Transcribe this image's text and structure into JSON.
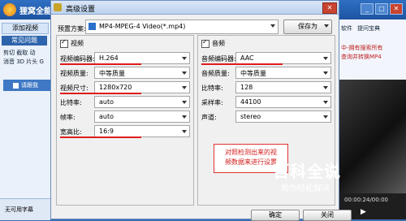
{
  "bg_app": {
    "title": "狸窝全能转",
    "tab_add_video": "添加视频",
    "tab_faq": "常见问题",
    "menu_lines": [
      "剪切 截取 动",
      "消音 3D 片头 G"
    ],
    "row_text": "请跟我",
    "bottom_text": "无可用字幕",
    "right_tabs": [
      "软件",
      "提问宝典"
    ],
    "right_links": [
      "中-拥有搜索所有",
      "查询并转换MP4"
    ],
    "time_text": "00:00:24/00:00",
    "play_icon": "play-icon"
  },
  "dialog": {
    "title": "高级设置",
    "preset_label": "预置方案:",
    "preset_value": "MP4-MPEG-4 Video(*.mp4)",
    "save_as": "保存为",
    "video": {
      "header": "视频",
      "fields": [
        {
          "label": "视频编码器:",
          "value": "H.264"
        },
        {
          "label": "视频质量:",
          "value": "中等质量"
        },
        {
          "label": "视频尺寸:",
          "value": "1280x720"
        },
        {
          "label": "比特率:",
          "value": "auto"
        },
        {
          "label": "帧率:",
          "value": "auto"
        },
        {
          "label": "宽高比:",
          "value": "16:9"
        }
      ]
    },
    "audio": {
      "header": "音频",
      "fields": [
        {
          "label": "音频编码器:",
          "value": "AAC"
        },
        {
          "label": "音频质量:",
          "value": "中等质量"
        },
        {
          "label": "比特率:",
          "value": "128"
        },
        {
          "label": "采样率:",
          "value": "44100"
        },
        {
          "label": "声道:",
          "value": "stereo"
        }
      ]
    },
    "annotation_line1": "对照检测出来的视",
    "annotation_line2": "频数据来进行设置",
    "ok": "确定",
    "close": "关闭"
  },
  "watermark": {
    "big": "百科全说",
    "small": "助你轻松解决"
  },
  "colors": {
    "accent_blue": "#3a6fb0",
    "highlight_red": "#e01b1b"
  }
}
